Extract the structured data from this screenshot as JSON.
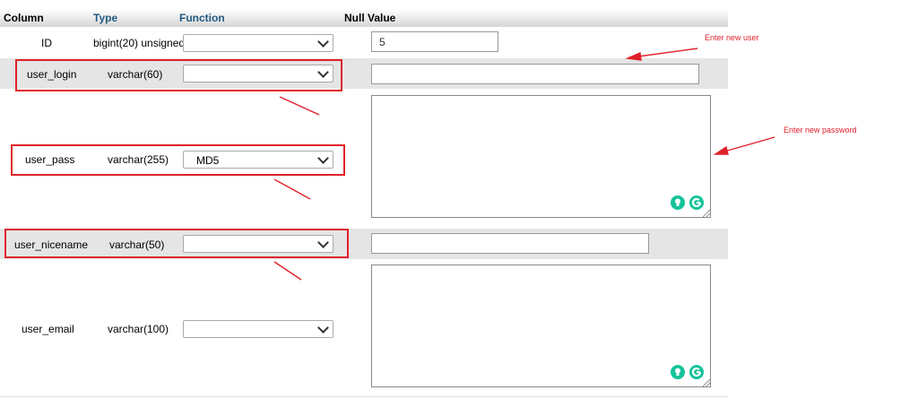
{
  "headers": {
    "column": "Column",
    "type": "Type",
    "function": "Function",
    "null": "Null",
    "value": "Value"
  },
  "rows": [
    {
      "column": "ID",
      "type": "bigint(20) unsigned",
      "function": "",
      "value": "5"
    },
    {
      "column": "user_login",
      "type": "varchar(60)",
      "function": "",
      "value": ""
    },
    {
      "column": "user_pass",
      "type": "varchar(255)",
      "function": "MD5",
      "value": ""
    },
    {
      "column": "user_nicename",
      "type": "varchar(50)",
      "function": "",
      "value": ""
    },
    {
      "column": "user_email",
      "type": "varchar(100)",
      "function": "",
      "value": ""
    }
  ],
  "annotations": {
    "new_user": "Enter new user",
    "new_password": "Enter new password"
  },
  "colors": {
    "annotation_red": "#e0202a",
    "header_link": "#235a81",
    "shade_row": "#e5e5e5",
    "grammarly_green": "#15c39a"
  },
  "icons": [
    "chevron-down-icon",
    "lightbulb-icon",
    "grammarly-icon",
    "resize-grip-icon"
  ]
}
